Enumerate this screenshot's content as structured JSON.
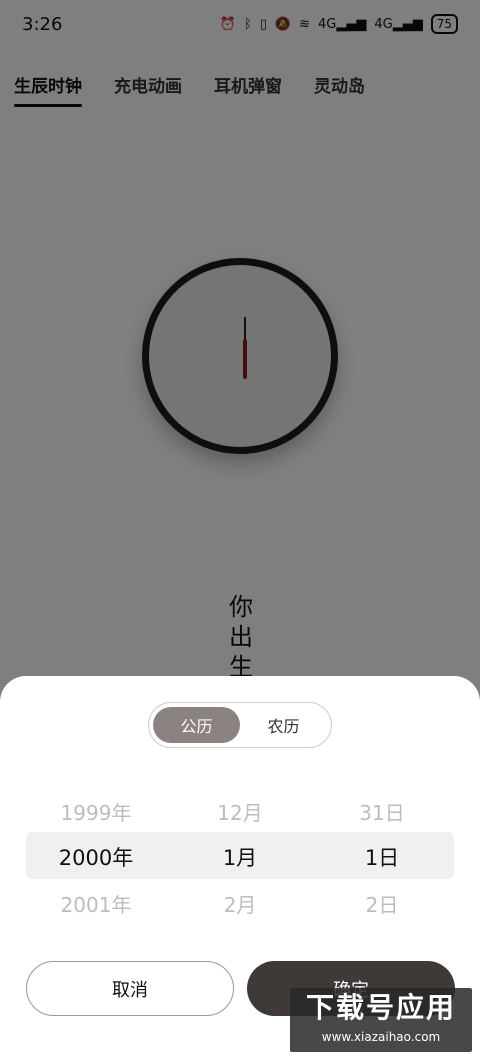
{
  "status": {
    "time": "3:26",
    "icons": [
      "alarm-icon",
      "bluetooth-icon",
      "vibrate-icon",
      "mute-icon",
      "wifi-icon",
      "4g-signal-icon",
      "4g-signal-icon"
    ],
    "signal1": "4G",
    "signal2": "4G",
    "battery": "75"
  },
  "tabs": [
    "生辰时钟",
    "充电动画",
    "耳机弹窗",
    "灵动岛"
  ],
  "background_text": [
    "你",
    "出",
    "生"
  ],
  "sheet": {
    "segment": {
      "solar": "公历",
      "lunar": "农历"
    },
    "picker": {
      "year": [
        "1999年",
        "2000年",
        "2001年"
      ],
      "month": [
        "12月",
        "1月",
        "2月"
      ],
      "day": [
        "31日",
        "1日",
        "2日"
      ]
    },
    "cancel_label": "取消",
    "confirm_label": "确定"
  },
  "watermark": {
    "title": "下载号应用",
    "url": "www.xiazaihao.com"
  },
  "colors": {
    "segment_active": "#8b8380",
    "confirm_button": "#3f3a38",
    "clock_hand": "#8a1c1c"
  }
}
